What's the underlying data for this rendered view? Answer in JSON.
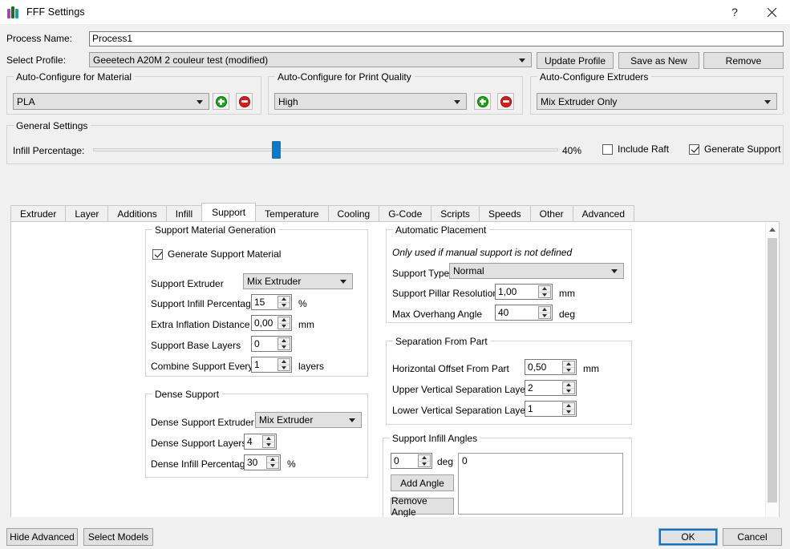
{
  "window": {
    "title": "FFF Settings",
    "icon": "app-bars-icon",
    "help_label": "?",
    "close_label": "✕"
  },
  "top_form": {
    "process_name_label": "Process Name:",
    "process_name_value": "Process1",
    "select_profile_label": "Select Profile:",
    "select_profile_value": "Geeetech A20M 2 couleur test (modified)",
    "update_profile_label": "Update Profile",
    "save_as_new_label": "Save as New",
    "remove_label": "Remove"
  },
  "material_group": {
    "title": "Auto-Configure for Material",
    "value": "PLA",
    "add_label": "add-material",
    "remove_label": "remove-material"
  },
  "quality_group": {
    "title": "Auto-Configure for Print Quality",
    "value": "High",
    "add_label": "add-quality",
    "remove_label": "remove-quality"
  },
  "extruders_group": {
    "title": "Auto-Configure Extruders",
    "value": "Mix Extruder Only"
  },
  "general_settings": {
    "title": "General Settings",
    "infill_label": "Infill Percentage:",
    "infill_value": "40%",
    "infill_percent": 40,
    "include_raft_label": "Include Raft",
    "include_raft_checked": false,
    "generate_support_label": "Generate Support",
    "generate_support_checked": true
  },
  "tabs": [
    {
      "label": "Extruder",
      "active": false
    },
    {
      "label": "Layer",
      "active": false
    },
    {
      "label": "Additions",
      "active": false
    },
    {
      "label": "Infill",
      "active": false
    },
    {
      "label": "Support",
      "active": true
    },
    {
      "label": "Temperature",
      "active": false
    },
    {
      "label": "Cooling",
      "active": false
    },
    {
      "label": "G-Code",
      "active": false
    },
    {
      "label": "Scripts",
      "active": false
    },
    {
      "label": "Speeds",
      "active": false
    },
    {
      "label": "Other",
      "active": false
    },
    {
      "label": "Advanced",
      "active": false
    }
  ],
  "support_material_generation": {
    "title": "Support Material Generation",
    "generate_checkbox_label": "Generate Support Material",
    "generate_checked": true,
    "support_extruder_label": "Support Extruder",
    "support_extruder_value": "Mix Extruder",
    "support_infill_label": "Support Infill Percentage",
    "support_infill_value": "15",
    "support_infill_unit": "%",
    "extra_inflation_label": "Extra Inflation Distance",
    "extra_inflation_value": "0,00",
    "extra_inflation_unit": "mm",
    "base_layers_label": "Support Base Layers",
    "base_layers_value": "0",
    "combine_label": "Combine Support Every",
    "combine_value": "1",
    "combine_unit": "layers"
  },
  "dense_support": {
    "title": "Dense Support",
    "extruder_label": "Dense Support Extruder",
    "extruder_value": "Mix Extruder",
    "layers_label": "Dense Support Layers",
    "layers_value": "4",
    "infill_label": "Dense Infill Percentage",
    "infill_value": "30",
    "infill_unit": "%"
  },
  "automatic_placement": {
    "title": "Automatic Placement",
    "note": "Only used if manual support is not defined",
    "support_type_label": "Support Type",
    "support_type_value": "Normal",
    "pillar_resolution_label": "Support Pillar Resolution",
    "pillar_resolution_value": "1,00",
    "pillar_resolution_unit": "mm",
    "max_overhang_label": "Max Overhang Angle",
    "max_overhang_value": "40",
    "max_overhang_unit": "deg"
  },
  "separation_from_part": {
    "title": "Separation From Part",
    "horizontal_offset_label": "Horizontal Offset From Part",
    "horizontal_offset_value": "0,50",
    "horizontal_offset_unit": "mm",
    "upper_sep_label": "Upper Vertical Separation Layers",
    "upper_sep_value": "2",
    "lower_sep_label": "Lower Vertical Separation Layers",
    "lower_sep_value": "1"
  },
  "support_infill_angles": {
    "title": "Support Infill Angles",
    "angle_value": "0",
    "angle_unit": "deg",
    "add_label": "Add Angle",
    "remove_label": "Remove Angle",
    "list_items": "0"
  },
  "bottom_bar": {
    "hide_advanced_label": "Hide Advanced",
    "select_models_label": "Select Models",
    "ok_label": "OK",
    "cancel_label": "Cancel"
  },
  "colors": {
    "accent": "#0a7ac8",
    "focus": "#0078d7",
    "window_bg": "#f0f0f0",
    "panel_bg": "#ffffff",
    "add_green": "#1aa61a",
    "remove_red": "#d02020"
  }
}
